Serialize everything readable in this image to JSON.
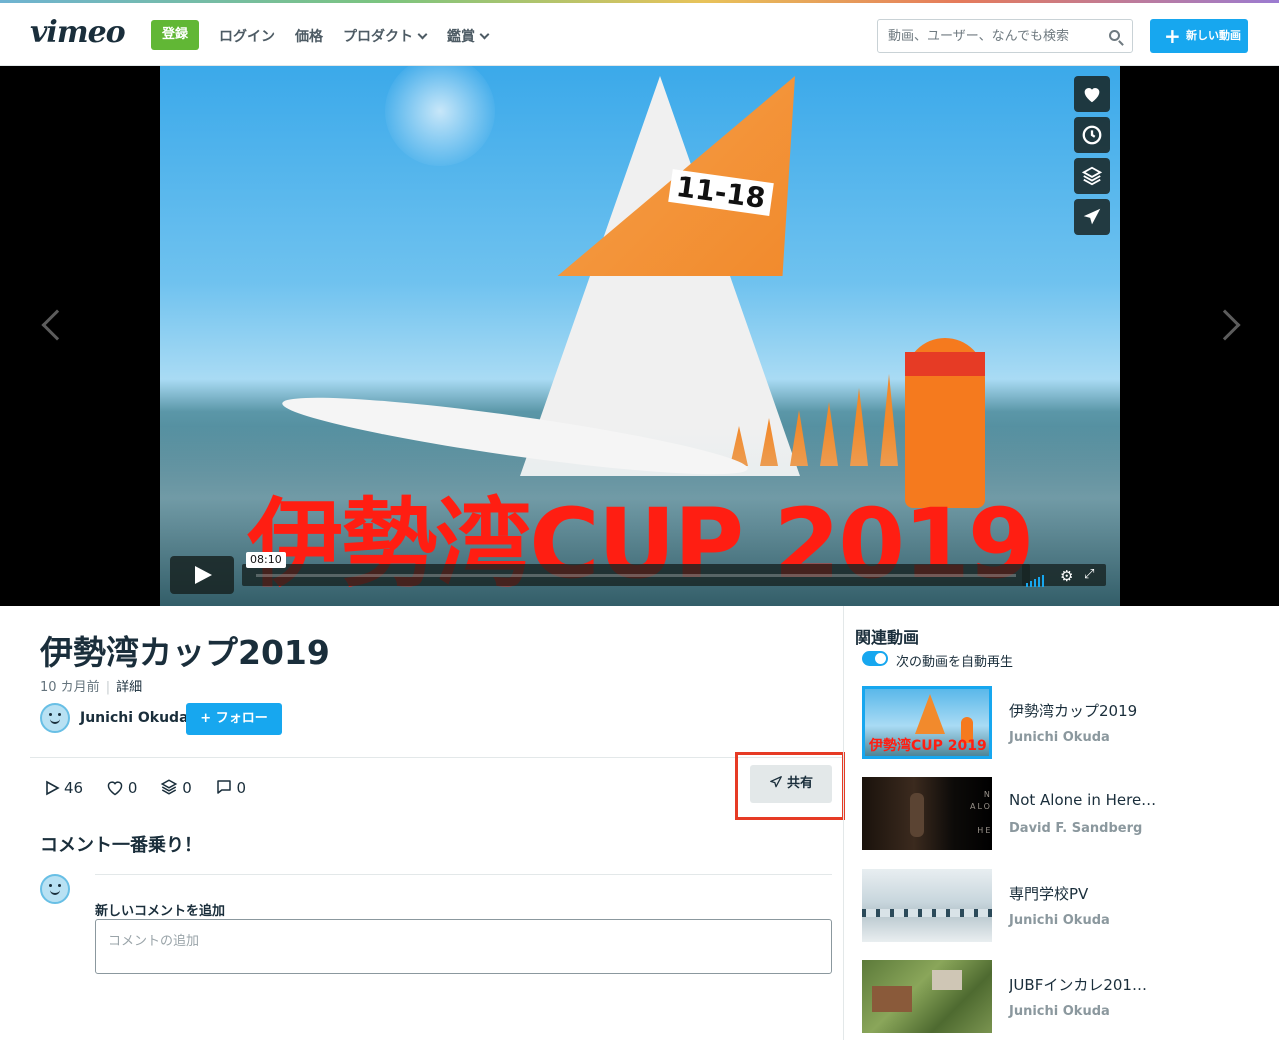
{
  "header": {
    "logo": "vimeo",
    "register_label": "登録",
    "nav": [
      {
        "label": "ログイン"
      },
      {
        "label": "価格"
      },
      {
        "label": "プロダクト"
      },
      {
        "label": "鑑賞"
      }
    ],
    "search_placeholder": "動画、ユーザー、なんでも検索",
    "new_video_label": "新しい動画"
  },
  "player": {
    "overlay_title": "伊勢湾CUP 2019",
    "sail_number": "11-18",
    "timecode": "08:10",
    "side_tools": [
      "heart-icon",
      "clock-icon",
      "layers-icon",
      "send-icon"
    ]
  },
  "video": {
    "title": "伊勢湾カップ2019",
    "age": "10 カ月前",
    "details_link": "詳細",
    "owner": "Junichi Okuda",
    "follow_label": "+ フォロー",
    "stats": {
      "plays": "46",
      "likes": "0",
      "collections": "0",
      "comments": "0"
    },
    "share_label": "共有"
  },
  "comments": {
    "heading": "コメント一番乗り！",
    "add_label": "新しいコメントを追加",
    "placeholder": "コメントの追加"
  },
  "sidebar": {
    "heading": "関連動画",
    "autoplay_label": "次の動画を自動再生",
    "items": [
      {
        "title": "伊勢湾カップ2019",
        "author": "Junichi Okuda",
        "thumb_text": "伊勢湾CUP 2019"
      },
      {
        "title": "Not Alone in Here…",
        "author": "David F. Sandberg",
        "thumb_text": "NOT ALONE IN HERE"
      },
      {
        "title": "専門学校PV",
        "author": "Junichi Okuda"
      },
      {
        "title": "JUBFインカレ201…",
        "author": "Junichi Okuda"
      }
    ]
  },
  "colors": {
    "accent": "#17a7ef",
    "register": "#61b735",
    "highlight": "#e63b25",
    "overlay_text": "#ff1e12"
  }
}
